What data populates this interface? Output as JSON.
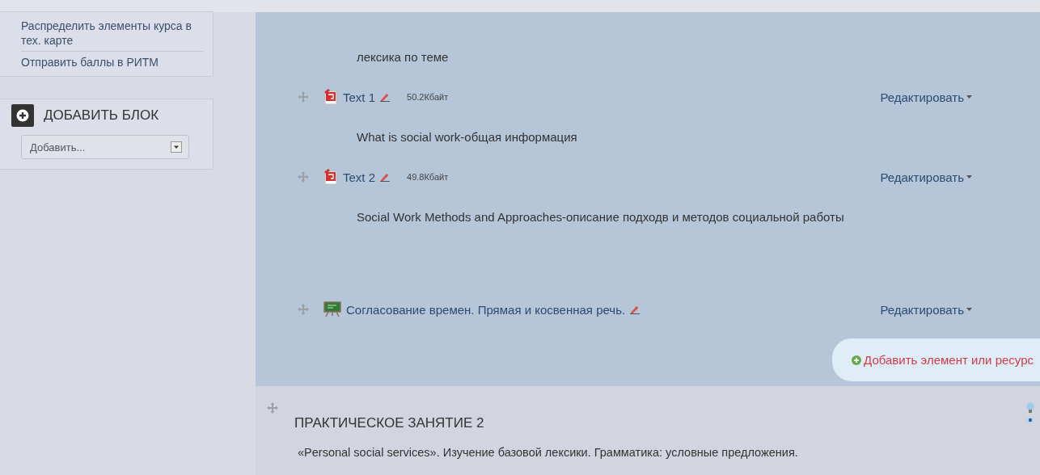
{
  "sidebar": {
    "links": [
      "Распределить элементы курса в тех. карте",
      "Отправить баллы в РИТМ"
    ],
    "add_block": {
      "title": "ДОБАВИТЬ БЛОК",
      "select": "Добавить..."
    }
  },
  "section": {
    "items": [
      {
        "kind": "text",
        "text": "лексика по теме"
      },
      {
        "kind": "file",
        "name": "Text 1",
        "size": "50.2Кбайт",
        "action": "Редактировать"
      },
      {
        "kind": "text",
        "text": "What is social work-общая информация"
      },
      {
        "kind": "file",
        "name": "Text 2",
        "size": "49.8Кбайт",
        "action": "Редактировать"
      },
      {
        "kind": "text",
        "text": "Social Work Methods and Approaches-описание подходв и методов социальной работы"
      },
      {
        "kind": "page",
        "name": "Согласование времен. Прямая и косвенная речь.",
        "action": "Редактировать"
      }
    ],
    "add_link": "Добавить элемент или ресурс"
  },
  "next_section": {
    "title": "ПРАКТИЧЕСКОЕ ЗАНЯТИЕ 2",
    "summary": "«Personal social services». Изучение базовой лексики. Грамматика: условные предложения."
  }
}
